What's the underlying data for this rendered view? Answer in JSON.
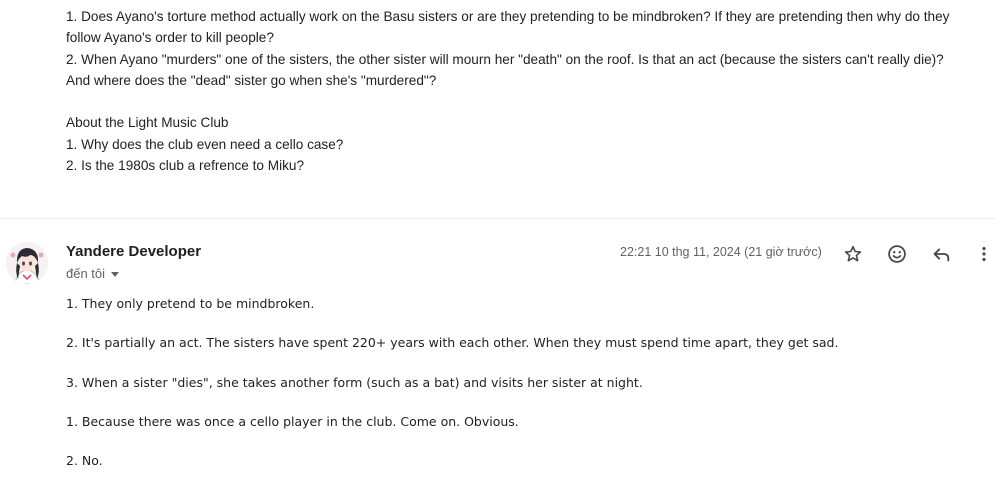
{
  "previous_message": {
    "lines": [
      "1. Does Ayano's torture method actually work on the Basu sisters or are they pretending to be mindbroken? If they are pretending then why do they",
      "follow Ayano's order to kill people?",
      "2. When Ayano \"murders\" one of the sisters, the other sister will mourn her \"death\" on the roof. Is that an act (because the sisters can't really die)?",
      "And where does the \"dead\" sister go when she's \"murdered\"?",
      "",
      "About the Light Music Club",
      "1. Why does the club even need a cello case?",
      "2. Is the 1980s club a refrence to Miku?"
    ]
  },
  "reply": {
    "sender_name": "Yandere Developer",
    "recipient_label": "đến tôi",
    "timestamp": "22:21 10 thg 11, 2024 (21 giờ trước)",
    "paragraphs": [
      "1. They only pretend to be mindbroken.",
      "2. It's partially an act. The sisters have spent 220+ years with each other. When they must spend time apart, they get sad.",
      "3. When a sister \"dies\", she takes another form (such as a bat) and visits her sister at night.",
      "1. Because there was once a cello player in the club. Come on. Obvious.",
      "2. No."
    ]
  },
  "icons": {
    "avatar": "anime-avatar",
    "star": "star-icon",
    "emoji": "emoji-icon",
    "reply": "reply-icon",
    "more": "more-vert-icon",
    "recipient_dropdown": "caret-down-icon"
  },
  "colors": {
    "icon": "#444746",
    "secondary_text": "#5f6368",
    "divider": "#ececec"
  }
}
